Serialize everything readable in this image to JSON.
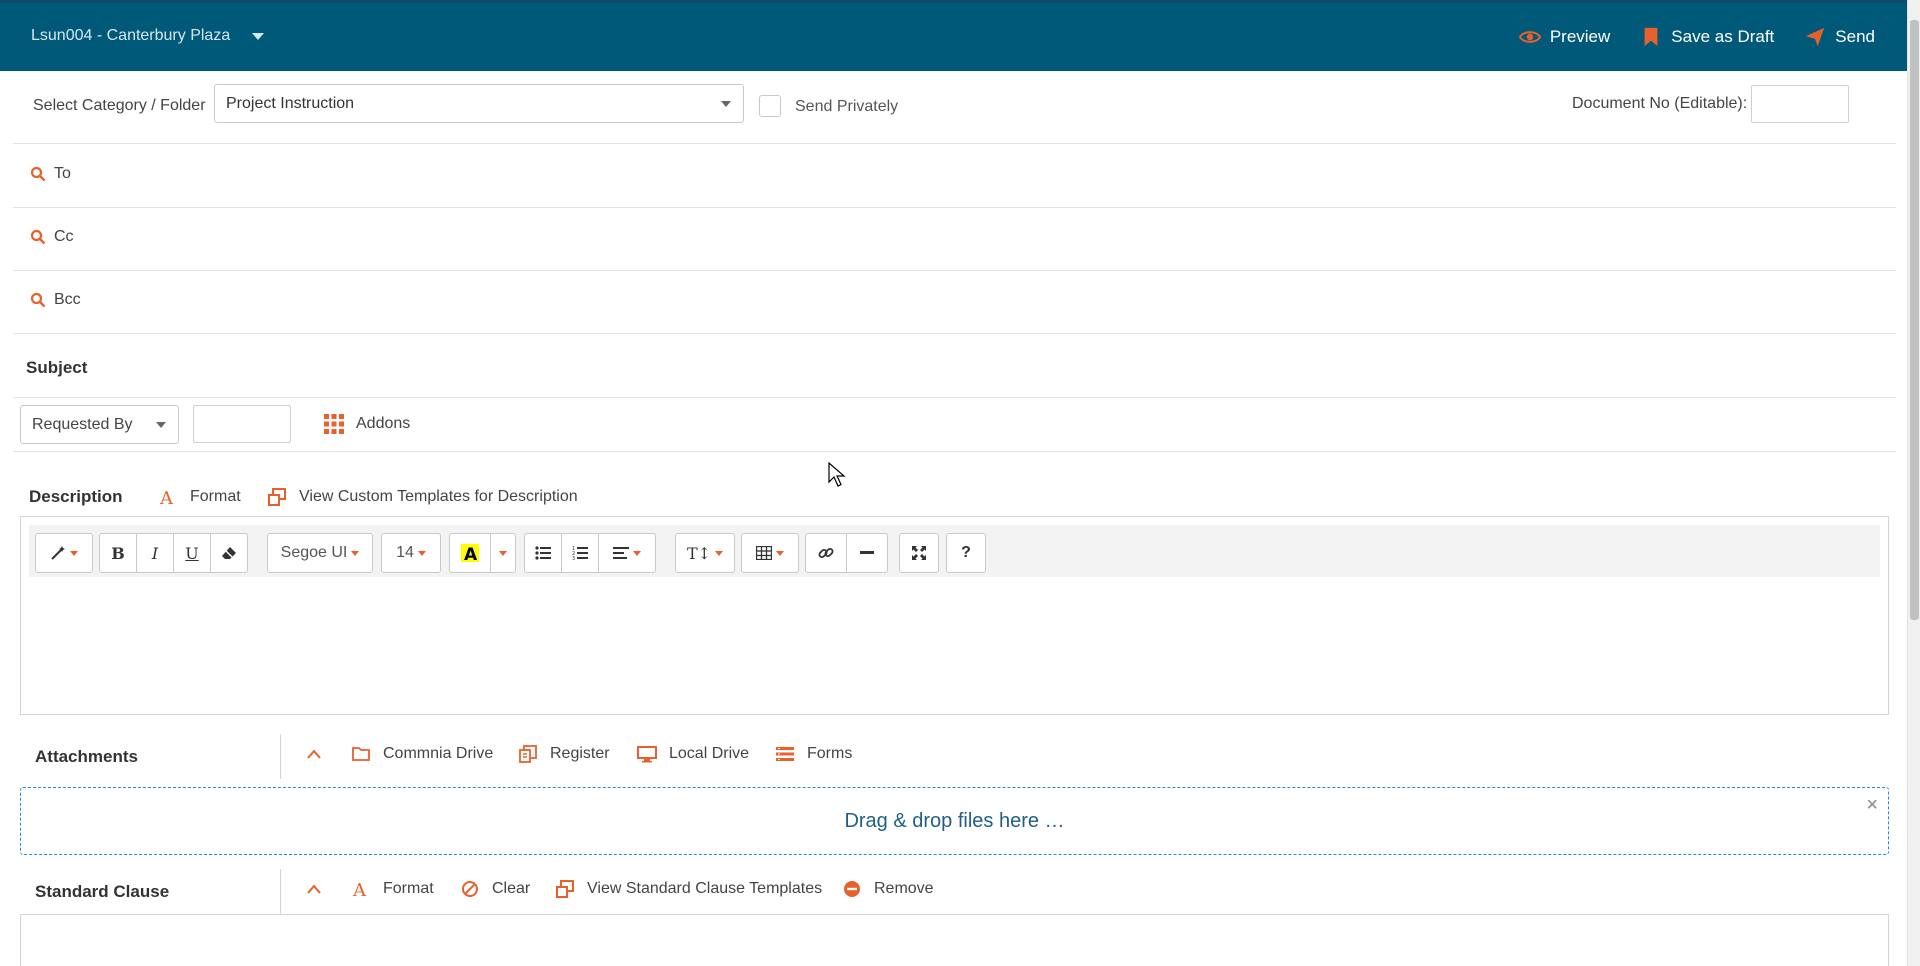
{
  "header": {
    "project": "Lsun004 - Canterbury Plaza",
    "actions": [
      {
        "label": "Preview",
        "icon": "eye-icon"
      },
      {
        "label": "Save as Draft",
        "icon": "bookmark-icon"
      },
      {
        "label": "Send",
        "icon": "send-icon"
      }
    ]
  },
  "form": {
    "category_label": "Select Category / Folder",
    "category_value": "Project Instruction",
    "send_privately": "Send Privately",
    "doc_no_label": "Document No (Editable):",
    "to": "To",
    "cc": "Cc",
    "bcc": "Bcc",
    "subject": "Subject",
    "requested_by": "Requested By",
    "addons": "Addons"
  },
  "description": {
    "title": "Description",
    "format": "Format",
    "templates": "View Custom Templates for Description",
    "font": "Segoe UI",
    "size": "14",
    "text_style": "T↕",
    "help": "?"
  },
  "attachments": {
    "title": "Attachments",
    "items": [
      "Commnia Drive",
      "Register",
      "Local Drive",
      "Forms"
    ],
    "drop_text": "Drag & drop files here …",
    "close": "×"
  },
  "clause": {
    "title": "Standard Clause",
    "format": "Format",
    "clear": "Clear",
    "templates": "View Standard Clause Templates",
    "remove": "Remove"
  },
  "colors": {
    "header_bg": "#01597a",
    "accent": "#e8612c",
    "link": "#1f5f86"
  }
}
